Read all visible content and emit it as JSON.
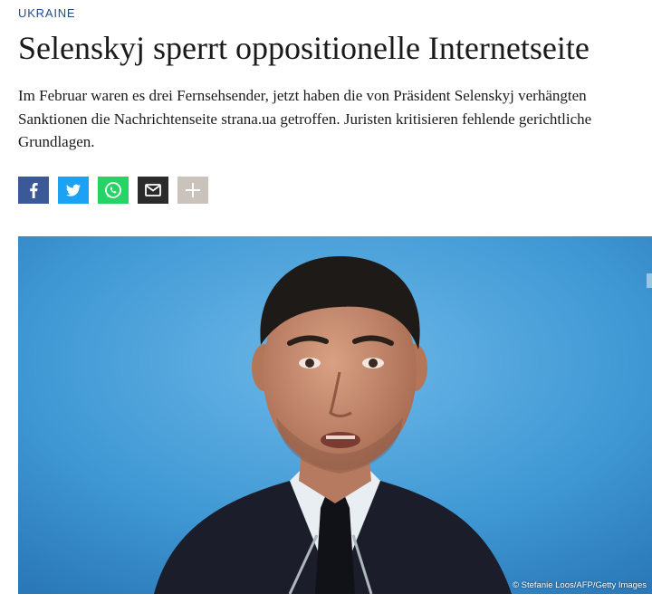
{
  "article": {
    "kicker": "UKRAINE",
    "headline": "Selenskyj sperrt oppositionelle Internetseite",
    "teaser": "Im Februar waren es drei Fernsehsender, jetzt haben die von Präsident Selenskyj verhängten Sanktionen die Nachrichtenseite strana.ua getroffen. Juristen kritisieren fehlende gerichtliche Grundlagen."
  },
  "share": {
    "buttons": [
      {
        "icon": "facebook-icon",
        "color": "#3b5998"
      },
      {
        "icon": "twitter-icon",
        "color": "#1da1f2"
      },
      {
        "icon": "whatsapp-icon",
        "color": "#25d366"
      },
      {
        "icon": "mail-icon",
        "color": "#2b2b2b"
      },
      {
        "icon": "plus-icon",
        "color": "#c9c3bb"
      }
    ]
  },
  "photo": {
    "credit": "© Stefanie Loos/AFP/Getty Images"
  }
}
